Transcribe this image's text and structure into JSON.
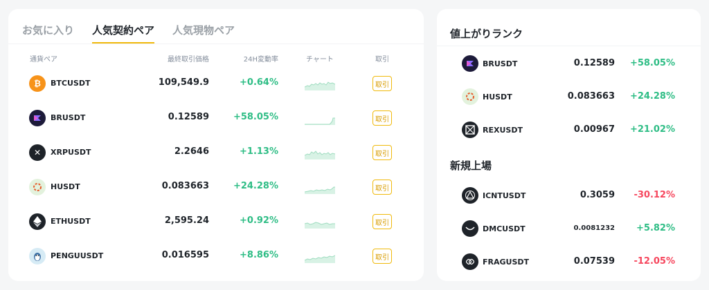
{
  "tabs": [
    {
      "label": "お気に入り"
    },
    {
      "label": "人気契約ペア"
    },
    {
      "label": "人気現物ペア"
    }
  ],
  "table": {
    "headers": {
      "pair": "通貨ペア",
      "price": "最終取引価格",
      "change": "24H変動率",
      "chart": "チャート",
      "trade": "取引"
    },
    "trade_label": "取引",
    "rows": [
      {
        "symbol": "BTCUSDT",
        "price": "109,549.9",
        "change": "+0.64%",
        "icon": "bitcoin-icon"
      },
      {
        "symbol": "BRUSDT",
        "price": "0.12589",
        "change": "+58.05%",
        "icon": "br-icon"
      },
      {
        "symbol": "XRPUSDT",
        "price": "2.2646",
        "change": "+1.13%",
        "icon": "xrp-icon"
      },
      {
        "symbol": "HUSDT",
        "price": "0.083663",
        "change": "+24.28%",
        "icon": "h-icon"
      },
      {
        "symbol": "ETHUSDT",
        "price": "2,595.24",
        "change": "+0.92%",
        "icon": "ethereum-icon"
      },
      {
        "symbol": "PENGUUSDT",
        "price": "0.016595",
        "change": "+8.86%",
        "icon": "pengu-icon"
      }
    ]
  },
  "ranking": {
    "title": "値上がりランク",
    "rows": [
      {
        "symbol": "BRUSDT",
        "price": "0.12589",
        "change": "+58.05%",
        "icon": "br-icon"
      },
      {
        "symbol": "HUSDT",
        "price": "0.083663",
        "change": "+24.28%",
        "icon": "h-icon"
      },
      {
        "symbol": "REXUSDT",
        "price": "0.00967",
        "change": "+21.02%",
        "icon": "rex-icon"
      }
    ]
  },
  "new_listings": {
    "title": "新規上場",
    "rows": [
      {
        "symbol": "ICNTUSDT",
        "price": "0.3059",
        "change": "-30.12%",
        "icon": "icnt-icon"
      },
      {
        "symbol": "DMCUSDT",
        "price": "0.0081232",
        "change": "+5.82%",
        "icon": "dmc-icon"
      },
      {
        "symbol": "FRAGUSDT",
        "price": "0.07539",
        "change": "-12.05%",
        "icon": "frag-icon"
      }
    ]
  },
  "colors": {
    "accent": "#f0b90b",
    "positive": "#2ebd85",
    "negative": "#f6465d",
    "text": "#1e2329",
    "muted": "#848e9c"
  }
}
